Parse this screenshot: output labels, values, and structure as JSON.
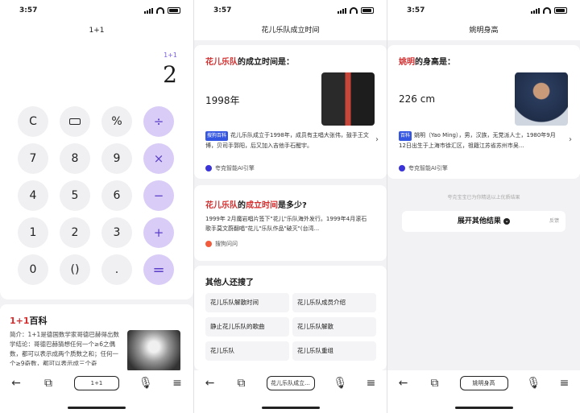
{
  "status_time": "3:57",
  "screen1": {
    "title": "1+1",
    "expression": "1+1",
    "result": "2",
    "keys": [
      "C",
      "",
      "%",
      "÷",
      "7",
      "8",
      "9",
      "×",
      "4",
      "5",
      "6",
      "−",
      "1",
      "2",
      "3",
      "+",
      "0",
      "()",
      ".",
      "="
    ],
    "baike_title_red": "1+1",
    "baike_title_rest": "百科",
    "baike_text": "简介：1+1是德国数学家哥德巴赫得出数学结论：哥德巴赫猜想任何一个≥6之偶数，都可以表示成两个质数之和；任何一个≥9奇数，都可以表示成三个奇",
    "bottom_query": "1+1"
  },
  "screen2": {
    "title": "花儿乐队成立时间",
    "q_red": "花儿乐队",
    "q_rest": "的成立时间是：",
    "answer": "1998年",
    "source_tag": "搜狗百科",
    "source_text": "花儿乐队成立于1998年，成员有主唱大张伟，鼓手王文博，贝司手郭阳，后又加入吉他手石醒宇。",
    "engine": "夸克智能AI引擎",
    "q2_a": "花儿乐队",
    "q2_b": "的",
    "q2_c": "成立时间",
    "q2_d": "是多少?",
    "q2_text": "1999年 2月魔岩唱片签下\"花儿\"乐队海外发行。1999年4月滚石歌手莫文蔚翻唱\"花儿\"乐队作品\"破灭\"(台湾...",
    "q2_source": "搜狗问问",
    "others_title": "其他人还搜了",
    "others": [
      "花儿乐队解散时间",
      "花儿乐队成员介绍",
      "静止花儿乐队的歌曲",
      "花儿乐队解散",
      "花儿乐队",
      "花儿乐队重组"
    ],
    "bottom_query": "花儿乐队成立..."
  },
  "screen3": {
    "title": "姚明身高",
    "q_red": "姚明",
    "q_rest": "的身高是：",
    "answer": "226 cm",
    "source_tag": "百科",
    "source_text": "姚明（Yao Ming），男，汉族，无党派人士，1980年9月12日出生于上海市徐汇区，祖籍江苏省苏州市吴...",
    "engine": "夸克智能AI引擎",
    "notice": "夸克宝宝已为你精选以上优质结果",
    "expand": "展开其他结果",
    "feedback": "反馈",
    "bottom_query": "姚明身高"
  }
}
